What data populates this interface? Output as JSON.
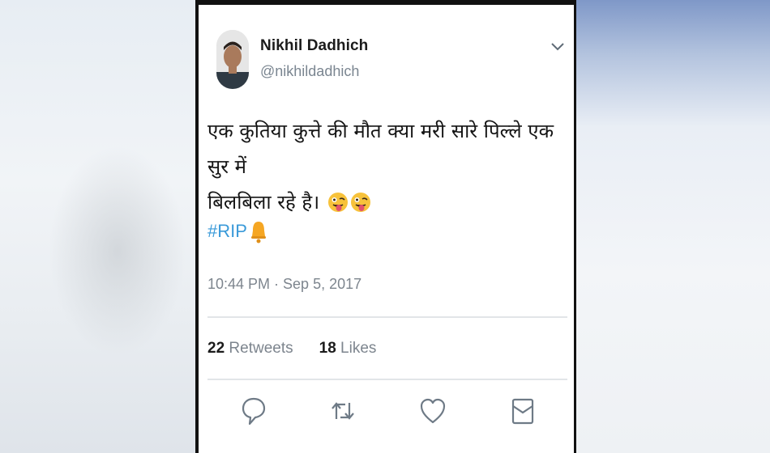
{
  "tweet": {
    "display_name": "Nikhil Dadhich",
    "handle": "@nikhildadhich",
    "text_line1": "एक कुतिया कुत्ते की मौत क्या मरी सारे पिल्ले एक सुर में",
    "text_line2": "बिलबिला रहे है।",
    "hashtag": "#RIP",
    "timestamp": "10:44 PM · Sep 5, 2017",
    "retweets_count": "22",
    "retweets_label": "Retweets",
    "likes_count": "18",
    "likes_label": "Likes"
  },
  "icons": {
    "menu": "chevron-down-icon",
    "emoji": "winking-tongue-face-icon",
    "bell": "bell-icon",
    "reply": "reply-icon",
    "retweet": "retweet-icon",
    "like": "heart-icon",
    "message": "envelope-icon"
  },
  "colors": {
    "link": "#3a9ad9",
    "muted": "#7d858e",
    "text": "#141414"
  }
}
